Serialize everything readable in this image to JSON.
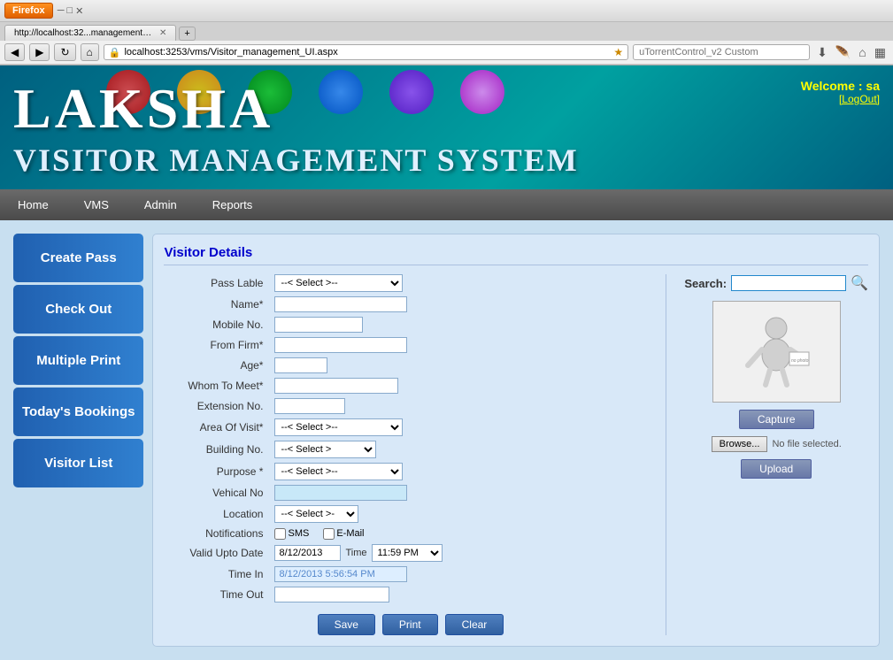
{
  "browser": {
    "firefox_label": "Firefox",
    "url": "localhost:3253/vms/Visitor_management_UI.aspx",
    "tab_title": "http://localhost:32...management_UI.aspx",
    "search_placeholder": "uTorrentControl_v2 Custom"
  },
  "header": {
    "title_laksha": "LAKSHA",
    "title_vms": "VISITOR MANAGEMENT SYSTEM",
    "welcome_text": "Welcome :  sa",
    "logout_text": "[LogOut]"
  },
  "nav": {
    "items": [
      "Home",
      "VMS",
      "Admin",
      "Reports"
    ]
  },
  "sidebar": {
    "buttons": [
      "Create Pass",
      "Check Out",
      "Multiple Print",
      "Today's Bookings",
      "Visitor List"
    ]
  },
  "form": {
    "title": "Visitor Details",
    "fields": {
      "pass_label": "Pass Lable",
      "name_label": "Name*",
      "mobile_label": "Mobile No.",
      "from_firm_label": "From Firm*",
      "age_label": "Age*",
      "whom_to_meet_label": "Whom To Meet*",
      "extension_label": "Extension No.",
      "area_of_visit_label": "Area Of Visit*",
      "building_no_label": "Building No.",
      "purpose_label": "Purpose *",
      "vehical_label": "Vehical No",
      "location_label": "Location",
      "notifications_label": "Notifications",
      "valid_upto_label": "Valid Upto Date",
      "time_in_label": "Time In",
      "time_out_label": "Time Out"
    },
    "select_placeholder": "--< Select >--",
    "select_placeholder2": "--< Select >--",
    "select_placeholder3": "--< Select >--",
    "select_placeholder4": "--< Select >--",
    "select_placeholder5": "--< Select >-",
    "valid_date": "8/12/2013",
    "time_label": "Time",
    "time_value": "11:59 PM",
    "time_in_value": "8/12/2013 5:56:54 PM",
    "sms_label": "SMS",
    "email_label": "E-Mail",
    "buttons": {
      "save": "Save",
      "print": "Print",
      "clear": "Clear"
    }
  },
  "photo": {
    "search_label": "Search:",
    "search_placeholder": "",
    "no_photo_text": "no photo",
    "capture_btn": "Capture",
    "browse_btn": "Browse...",
    "file_status": "No file selected.",
    "upload_btn": "Upload"
  }
}
